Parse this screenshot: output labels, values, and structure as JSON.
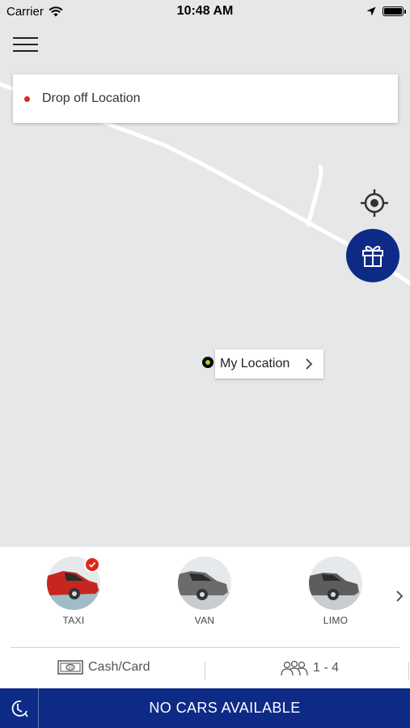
{
  "status_bar": {
    "carrier": "Carrier",
    "time": "10:48 AM",
    "battery_level": 0.9
  },
  "search": {
    "label": "Drop off Location"
  },
  "my_location": {
    "label": "My Location"
  },
  "vehicles": [
    {
      "name": "TAXI",
      "selected": true,
      "car_color": "#c6261f"
    },
    {
      "name": "VAN",
      "selected": false,
      "car_color": "#6b6b6b"
    },
    {
      "name": "LIMO",
      "selected": false,
      "car_color": "#5d5d5d"
    }
  ],
  "payment": {
    "label": "Cash/Card"
  },
  "passengers": {
    "label": "1 - 4"
  },
  "action": {
    "label": "NO CARS AVAILABLE"
  },
  "colors": {
    "brand": "#0d2a87",
    "map_bg": "#e5e7e8",
    "road": "#ffffff",
    "drop_dot": "#e0261b",
    "location_dot": "#a8d22a",
    "check": "#e0261b"
  },
  "icons": [
    "menu-icon",
    "locate-icon",
    "gift-icon",
    "chevron-right-icon",
    "cash-icon",
    "passengers-icon",
    "history-icon",
    "check-icon"
  ]
}
